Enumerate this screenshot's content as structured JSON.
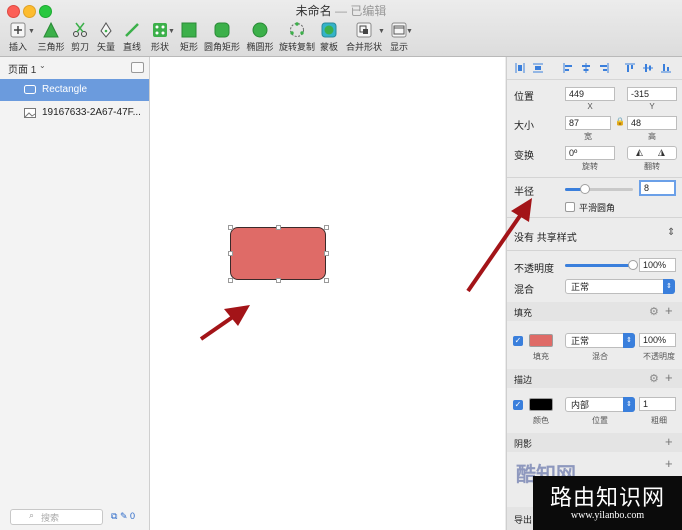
{
  "window": {
    "title": "未命名",
    "subtitle": "— 已编辑"
  },
  "toolbar": {
    "insert": "插入",
    "triangle": "三角形",
    "scissors": "剪刀",
    "vector": "矢量",
    "line": "直线",
    "shape": "形状",
    "rect": "矩形",
    "rounded_rect": "圆角矩形",
    "oval": "椭圆形",
    "rotate_copy": "旋转复制",
    "mask": "蒙板",
    "combine": "合并形状",
    "display": "显示"
  },
  "left_panel": {
    "page": "页面 1",
    "layers": [
      {
        "name": "Rectangle"
      },
      {
        "name": "19167633-2A67-47F..."
      }
    ],
    "search_placeholder": "搜索",
    "footer_count": "0"
  },
  "inspector": {
    "position_label": "位置",
    "x_value": "449",
    "y_value": "-315",
    "x_label": "X",
    "y_label": "Y",
    "size_label": "大小",
    "width_value": "87",
    "height_value": "48",
    "width_label": "宽",
    "height_label": "高",
    "transform_label": "变换",
    "rotate_value": "0º",
    "rotate_label": "旋转",
    "flip_label": "翻转",
    "radius_label": "半径",
    "radius_value": "8",
    "radius_fraction": 0.3,
    "smooth_corners_label": "平滑圆角",
    "shared_style": "没有 共享样式",
    "opacity_label": "不透明度",
    "opacity_value": "100%",
    "opacity_fraction": 1.0,
    "blend_label": "混合",
    "blend_value": "正常",
    "fill_title": "填充",
    "fill": {
      "color": "#df6b67",
      "blend": "正常",
      "opacity": "100%",
      "sub_fill": "填充",
      "sub_blend": "混合",
      "sub_opacity": "不透明度"
    },
    "border_title": "描边",
    "border": {
      "color": "#000000",
      "position": "内部",
      "width": "1",
      "sub_color": "颜色",
      "sub_position": "位置",
      "sub_width": "粗细"
    },
    "shadow_title": "阴影",
    "export_title": "导出"
  },
  "colors": {
    "accent": "#3a7fdc",
    "selection": "#6b9bdd",
    "arrow": "#a31418",
    "shape_fill": "#df6b67"
  },
  "watermark": {
    "logo": "酷知网",
    "title": "路由知识网",
    "url": "www.yilanbo.com"
  }
}
